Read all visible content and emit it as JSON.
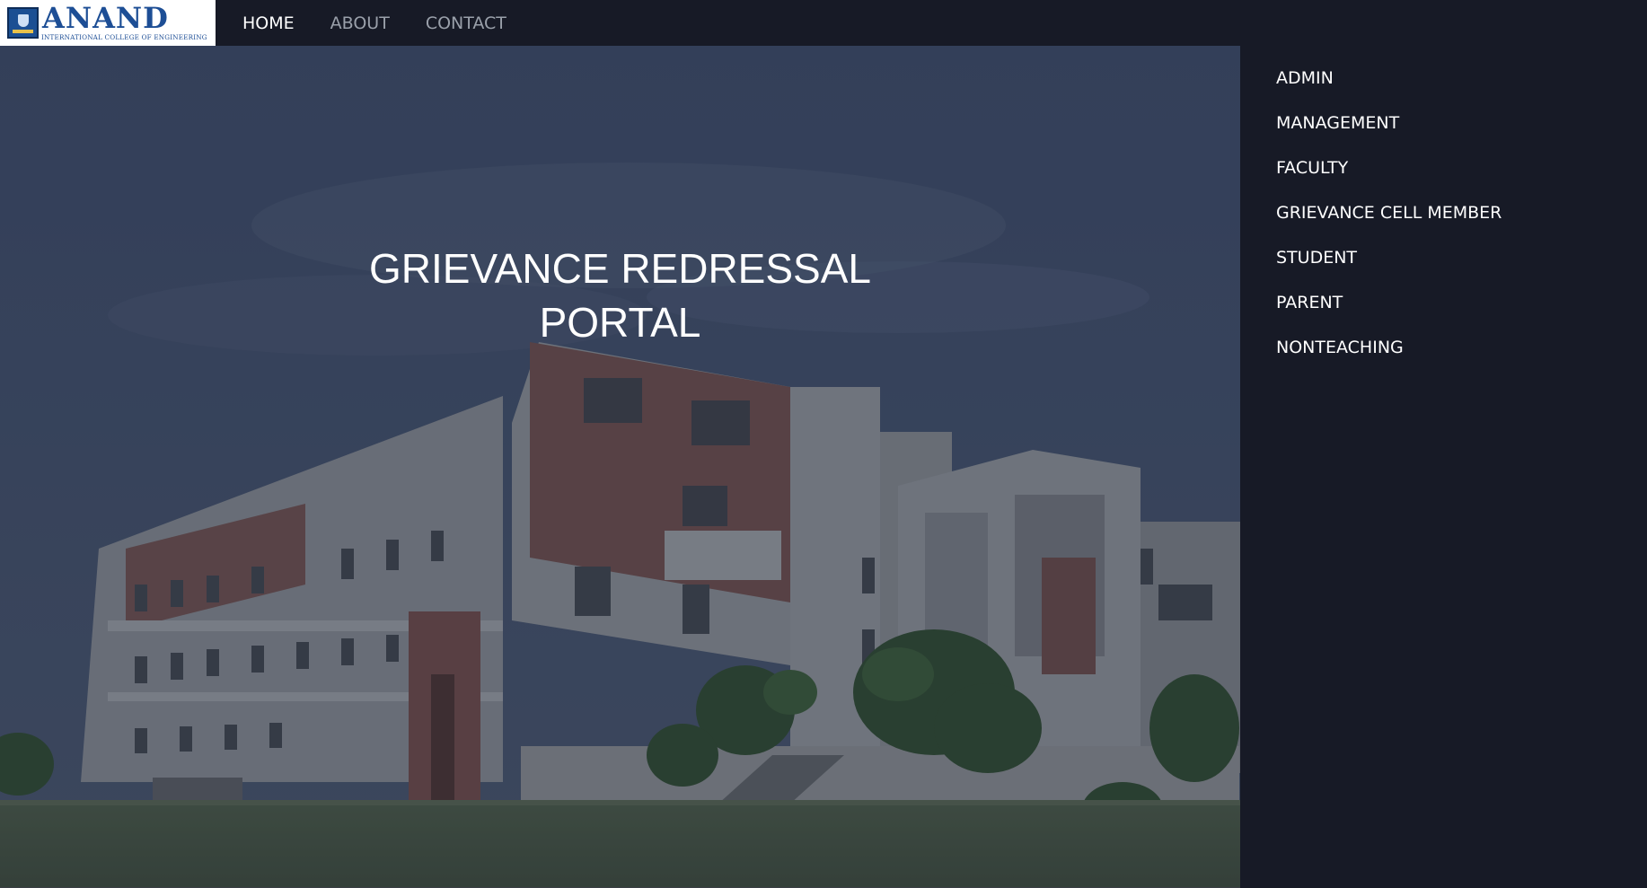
{
  "logo": {
    "name": "ANAND",
    "subtitle": "INTERNATIONAL COLLEGE OF ENGINEERING"
  },
  "nav": {
    "home": "HOME",
    "about": "ABOUT",
    "contact": "CONTACT"
  },
  "hero": {
    "title_line1": "GRIEVANCE REDRESSAL",
    "title_line2": "PORTAL"
  },
  "side_menu": {
    "items": [
      "ADMIN",
      "MANAGEMENT",
      "FACULTY",
      "GRIEVANCE CELL MEMBER",
      "STUDENT",
      "PARENT",
      "NONTEACHING"
    ]
  },
  "colors": {
    "navbar_bg": "#171a26",
    "active_link": "#ffffff",
    "inactive_link": "#9aa0aa",
    "logo_blue": "#1d4e95",
    "hero_overlay": "#2b3550"
  },
  "icons": {
    "logo_emblem": "college-crest-icon"
  }
}
